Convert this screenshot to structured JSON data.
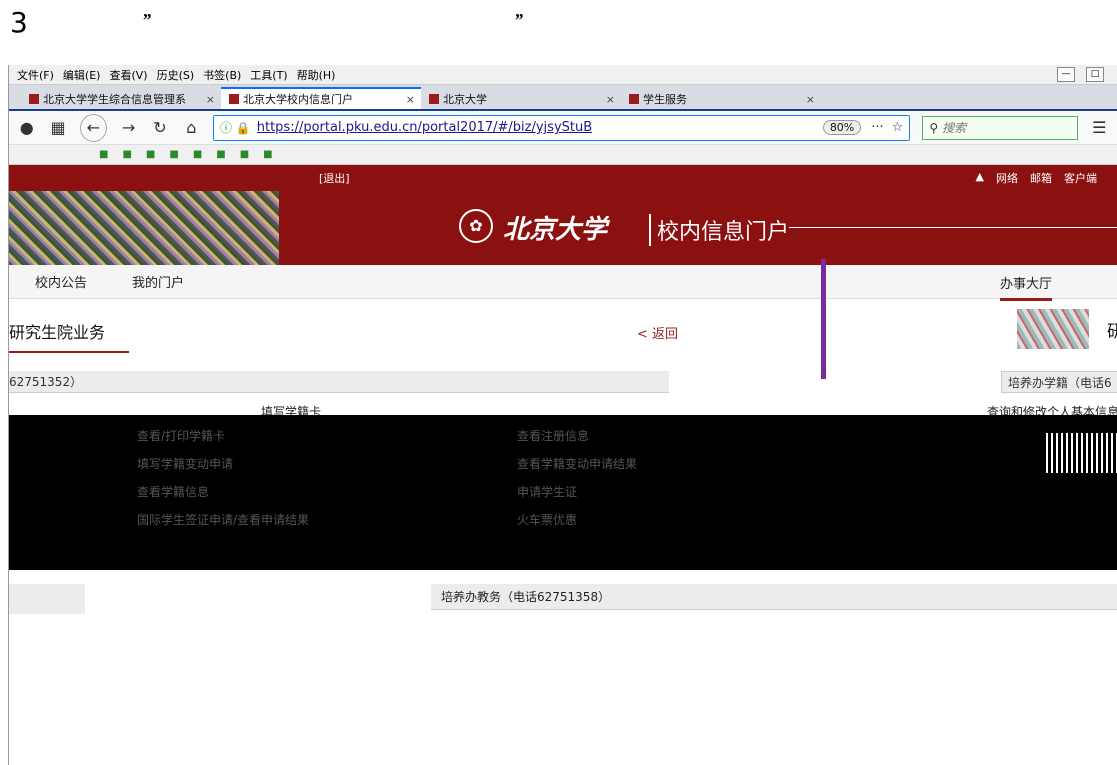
{
  "step": {
    "number": "3",
    "quote_open": "”",
    "quote_close": "”"
  },
  "browser": {
    "menu": [
      "文件(F)",
      "编辑(E)",
      "查看(V)",
      "历史(S)",
      "书签(B)",
      "工具(T)",
      "帮助(H)"
    ],
    "tabs": [
      "北京大学学生综合信息管理系",
      "北京大学校内信息门户",
      "北京大学",
      "学生服务"
    ],
    "url": "https://portal.pku.edu.cn/portal2017/#/biz/yjsyStuB",
    "zoom": "80%",
    "search_placeholder": "搜索",
    "more": "···"
  },
  "portal": {
    "logout": "[退出]",
    "top_links": [
      "网络",
      "邮箱",
      "客户端"
    ],
    "brand": "北京大学",
    "portal_name": "校内信息门户",
    "nav_tabs": [
      "校内公告",
      "我的门户"
    ],
    "hall": "办事大厅",
    "section_title": "研究生院业务",
    "back": "< 返回",
    "right_card_char": "研",
    "group_left": "62751352）",
    "group_right": "培养办学籍（电话6",
    "row_items": [
      "填写学籍卡",
      "查询和修改个人基本信息"
    ],
    "dark_links": [
      "查看/打印学籍卡",
      "查看注册信息",
      "填写学籍变动申请",
      "查看学籍变动申请结果",
      "查看学籍信息",
      "申请学生证",
      "国际学生签证申请/查看申请结果",
      "火车票优惠"
    ],
    "group2": "培养办教务（电话62751358）"
  }
}
